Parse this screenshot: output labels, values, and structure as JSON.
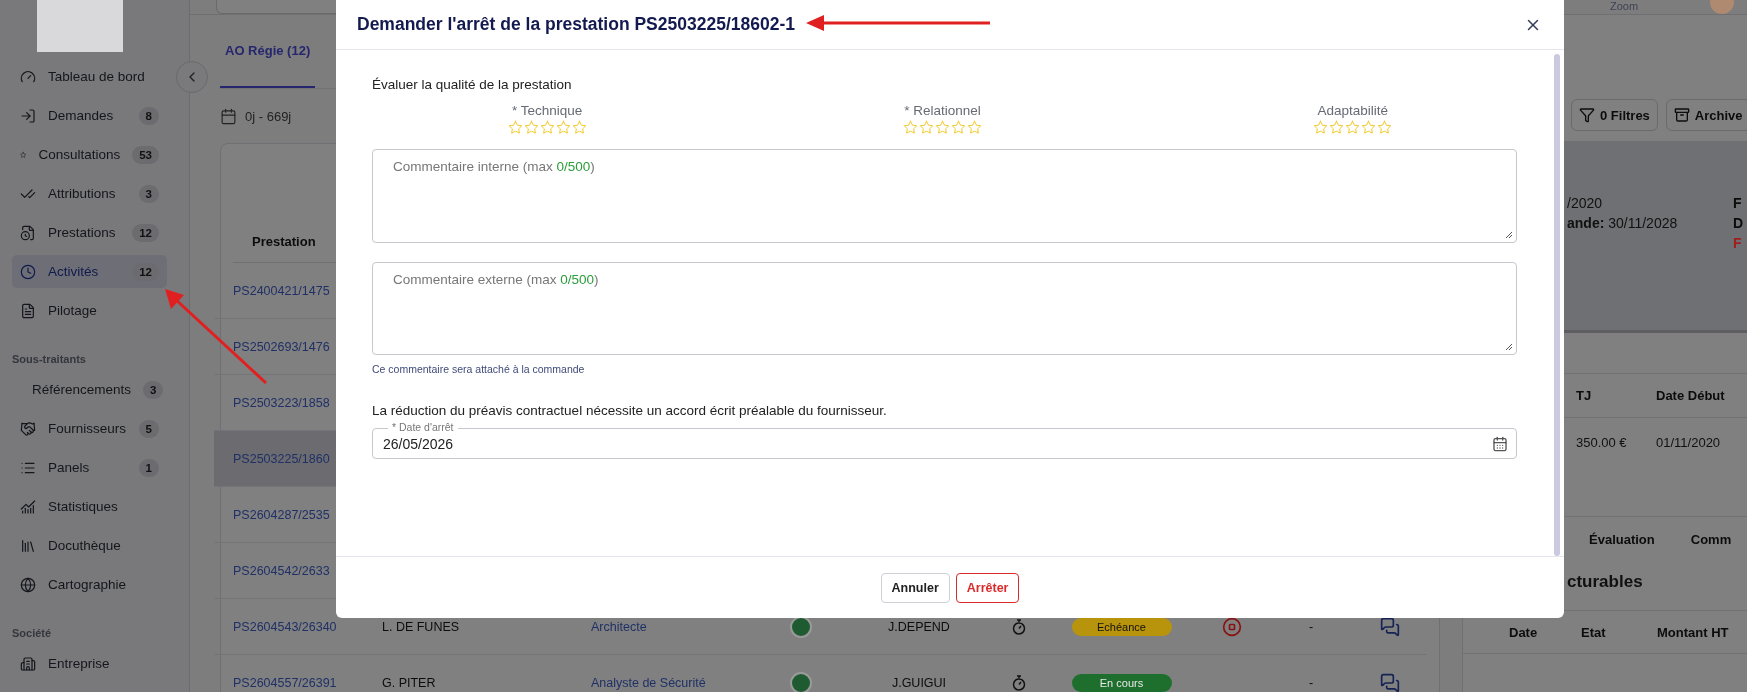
{
  "sidebar": {
    "sections": [
      {
        "items": [
          {
            "label": "Tableau de bord",
            "selected": false
          },
          {
            "label": "Demandes",
            "count": "8",
            "selected": false
          },
          {
            "label": "Consultations",
            "count": "53",
            "selected": false
          },
          {
            "label": "Attributions",
            "count": "3",
            "selected": false
          },
          {
            "label": "Prestations",
            "count": "12",
            "selected": false
          },
          {
            "label": "Activités",
            "count": "12",
            "selected": true
          },
          {
            "label": "Pilotage",
            "selected": false
          }
        ]
      },
      {
        "title": "Sous-traitants",
        "items": [
          {
            "label": "Référencements",
            "count": "3",
            "selected": false
          },
          {
            "label": "Fournisseurs",
            "count": "5",
            "selected": false
          },
          {
            "label": "Panels",
            "count": "1",
            "selected": false
          },
          {
            "label": "Statistiques",
            "selected": false
          },
          {
            "label": "Docuthèque",
            "selected": false
          },
          {
            "label": "Cartographie",
            "selected": false
          }
        ]
      },
      {
        "title": "Société",
        "items": [
          {
            "label": "Entreprise",
            "selected": false
          }
        ]
      }
    ]
  },
  "topbar": {
    "zoom_label": "Zoom"
  },
  "main": {
    "tabs": [
      {
        "label": "AO Régie (12)",
        "selected": true
      }
    ],
    "period": "0j - 669j",
    "table": {
      "columns": [
        "Prestation"
      ],
      "rows": [
        {
          "prestation": "PS2400421/1475",
          "selected": false
        },
        {
          "prestation": "PS2502693/1476",
          "selected": false
        },
        {
          "prestation": "PS2503223/1858",
          "selected": false
        },
        {
          "prestation": "PS2503225/1860",
          "selected": true
        },
        {
          "prestation": "PS2604287/2535",
          "selected": false
        },
        {
          "prestation": "PS2604542/2633",
          "selected": false
        },
        {
          "prestation": "PS2604543/26340",
          "consultant": "L. DE FUNES",
          "role": "Architecte",
          "manager": "J.DEPEND",
          "status": {
            "label": "Echéance",
            "color": "#b8930c"
          },
          "stoppable": true,
          "end": "-",
          "selected": false
        },
        {
          "prestation": "PS2604557/26391",
          "consultant": "G. PITER",
          "role": "Analyste de Sécurité",
          "manager": "J.GUIGUI",
          "status": {
            "label": "En cours",
            "color": "#1e6f2e"
          },
          "stoppable": false,
          "end": "-",
          "selected": false
        }
      ]
    }
  },
  "detail_panel": {
    "buttons": [
      {
        "label": "0 Filtres",
        "kind": "filter"
      },
      {
        "label": "Archive",
        "kind": "archive"
      }
    ],
    "summary": {
      "left": [
        {
          "value": "/2020"
        },
        {
          "label": "ande:",
          "value": "30/11/2028"
        }
      ],
      "right": [
        {
          "text": "F",
          "alert": false
        },
        {
          "text": "D",
          "alert": false
        },
        {
          "text": "F",
          "alert": true
        }
      ]
    },
    "lines_table": {
      "columns": [
        "TJ",
        "Date Début"
      ],
      "rows": [
        [
          "350.00 €",
          "01/11/2020"
        ]
      ]
    },
    "tabs": [
      {
        "label": "Évaluation",
        "selected": false
      },
      {
        "label": "Comm",
        "selected": false
      }
    ],
    "heading": "cturables",
    "invoices_table": {
      "columns": [
        "Date",
        "Etat",
        "Montant HT"
      ]
    }
  },
  "dialog": {
    "title": "Demander l'arrêt de la prestation PS2503225/18602-1",
    "rating_title": "Évaluer la qualité de la prestation",
    "ratings": [
      {
        "label": "* Technique",
        "stars": 0
      },
      {
        "label": "* Relationnel",
        "stars": 0
      },
      {
        "label": "Adaptabilité",
        "stars": 0
      }
    ],
    "comments": [
      {
        "label": "Commentaire interne (max ",
        "count": "0/500",
        "label_end": ")"
      },
      {
        "label": "Commentaire externe (max ",
        "count": "0/500",
        "label_end": ")",
        "hint": "Ce commentaire sera attaché à la commande"
      }
    ],
    "notice": "La réduction du préavis contractuel nécessite un accord écrit préalable du fournisseur.",
    "date_field": {
      "label": "* Date d'arrêt",
      "value": "26/05/2026"
    },
    "buttons": [
      {
        "label": "Annuler",
        "kind": "secondary"
      },
      {
        "label": "Arrêter",
        "kind": "danger"
      }
    ]
  }
}
